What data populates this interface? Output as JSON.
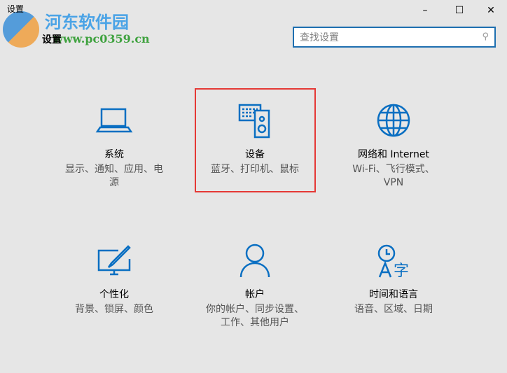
{
  "window": {
    "title": "设置",
    "minimize": "–",
    "maximize": "☐",
    "close": "✕"
  },
  "page_title": "设置",
  "watermark": {
    "name": "河东软件园",
    "url": "www.pc0359.cn"
  },
  "search": {
    "placeholder": "查找设置",
    "icon": "search-icon"
  },
  "accent": "#0a6fc2",
  "highlight_color": "#e53935",
  "tiles": [
    {
      "title": "系统",
      "desc": "显示、通知、应用、电源",
      "icon": "laptop-icon"
    },
    {
      "title": "设备",
      "desc": "蓝牙、打印机、鼠标",
      "icon": "devices-icon"
    },
    {
      "title": "网络和 Internet",
      "desc": "Wi-Fi、飞行模式、VPN",
      "icon": "globe-icon"
    },
    {
      "title": "个性化",
      "desc": "背景、锁屏、颜色",
      "icon": "personalization-icon"
    },
    {
      "title": "帐户",
      "desc": "你的帐户、同步设置、工作、其他用户",
      "icon": "person-icon"
    },
    {
      "title": "时间和语言",
      "desc": "语音、区域、日期",
      "icon": "time-language-icon"
    }
  ]
}
